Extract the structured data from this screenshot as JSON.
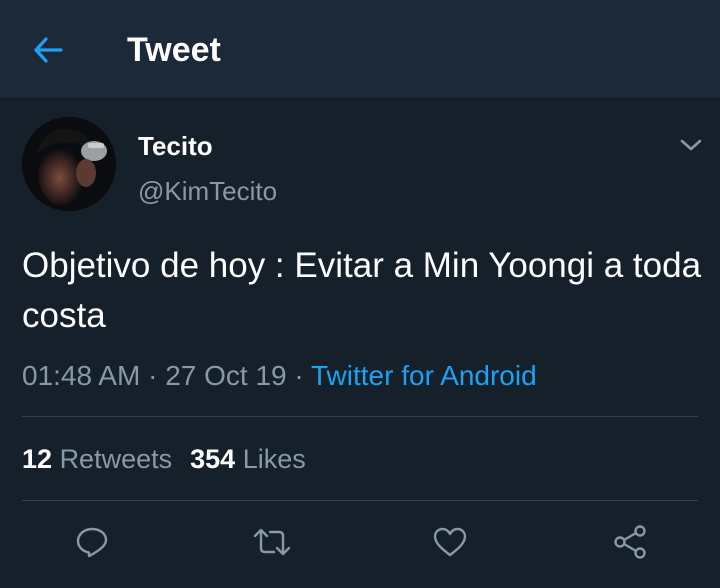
{
  "header": {
    "title": "Tweet",
    "back_icon": "arrow-left-icon",
    "accent_color": "#1da1f2"
  },
  "tweet": {
    "author": {
      "display_name": "Tecito",
      "handle": "@KimTecito"
    },
    "text": "Objetivo de hoy : Evitar a Min Yoongi a toda costa",
    "time": "01:48 AM",
    "date": "27 Oct 19",
    "separator": "·",
    "source": "Twitter for Android",
    "retweets": {
      "count": "12",
      "label": "Retweets"
    },
    "likes": {
      "count": "354",
      "label": "Likes"
    }
  },
  "actions": [
    {
      "icon": "reply-icon"
    },
    {
      "icon": "retweet-icon"
    },
    {
      "icon": "like-icon"
    },
    {
      "icon": "share-icon"
    }
  ],
  "colors": {
    "background": "#15202b",
    "header_background": "#1c2938",
    "secondary_text": "#8899a6",
    "link": "#1da1f2",
    "divider": "#38444d"
  }
}
